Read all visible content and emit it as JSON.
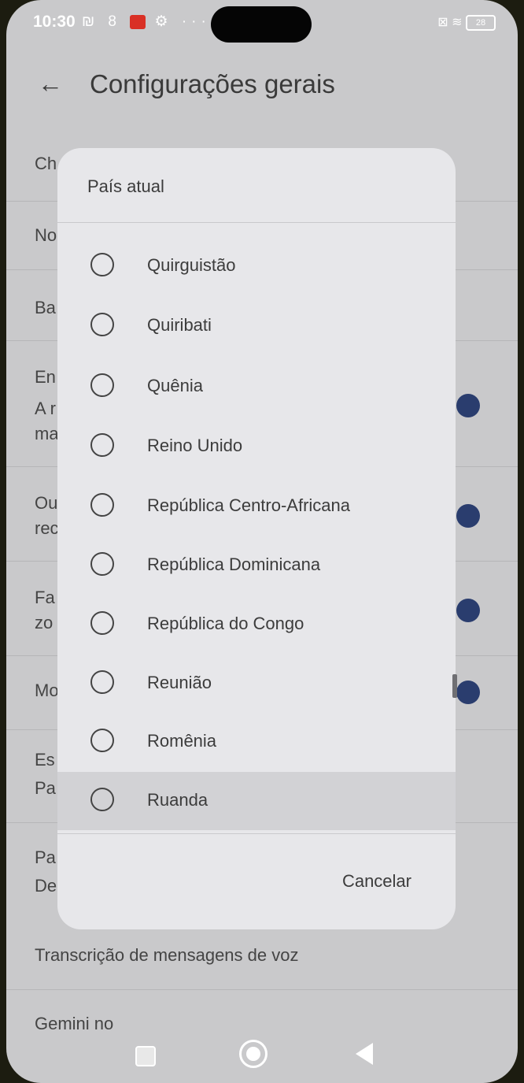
{
  "status_bar": {
    "time": "10:30",
    "left_icons": "₪ 8",
    "right_icons": "⊠ ≋",
    "battery": "28"
  },
  "app_bar": {
    "title": "Configurações gerais",
    "back_icon": "arrow-left-icon"
  },
  "background_settings": {
    "rows": [
      {
        "label": "Ch",
        "has_toggle": false
      },
      {
        "label": "No",
        "has_toggle": false
      },
      {
        "label": "Ba",
        "has_toggle": false
      },
      {
        "label": "En",
        "line2": "A r",
        "line3": "ma",
        "has_toggle": true
      },
      {
        "label": "Ou",
        "line2": "rec",
        "has_toggle": true
      },
      {
        "label": "Fa",
        "line2": "zo",
        "has_toggle": true
      },
      {
        "label": "Mo",
        "has_toggle": true
      },
      {
        "label": "Es",
        "line2": "Pa",
        "has_toggle": false
      },
      {
        "label": "Pa",
        "line2": "De",
        "has_toggle": false
      },
      {
        "label": "Transcrição de mensagens de voz",
        "has_toggle": false
      },
      {
        "label": "Gemini no",
        "has_toggle": false
      }
    ]
  },
  "dialog": {
    "title": "País atual",
    "options": [
      "Quirguistão",
      "Quiribati",
      "Quênia",
      "Reino Unido",
      "República Centro-Africana",
      "República Dominicana",
      "República do Congo",
      "Reunião",
      "Romênia",
      "Ruanda"
    ],
    "cancel_label": "Cancelar"
  },
  "nav_bar": {
    "recent_icon": "recents-square-icon",
    "home_icon": "home-circle-icon",
    "back_icon": "back-triangle-icon"
  },
  "colors": {
    "accent_toggle": "#2a3d6e",
    "dialog_bg": "#e7e7ea",
    "scrim_bg": "#c9c9cb"
  }
}
